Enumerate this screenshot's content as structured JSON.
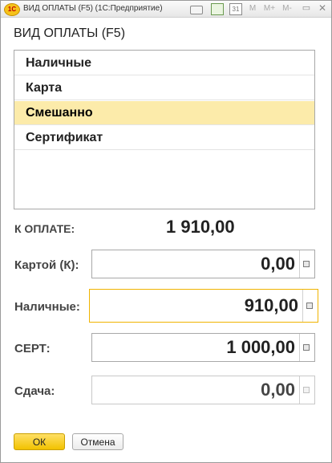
{
  "window": {
    "title": "ВИД ОПЛАТЫ (F5)  (1С:Предприятие)",
    "logo_text": "1С",
    "toolbar": {
      "m_label": "M",
      "m_plus_label": "M+",
      "m_minus_label": "M-",
      "calendar_label": "31"
    }
  },
  "form": {
    "title": "ВИД ОПЛАТЫ (F5)"
  },
  "payment_types": [
    {
      "label": "Наличные",
      "selected": false
    },
    {
      "label": "Карта",
      "selected": false
    },
    {
      "label": "Смешанно",
      "selected": true
    },
    {
      "label": "Сертификат",
      "selected": false
    }
  ],
  "to_pay": {
    "label": "К ОПЛАТЕ:",
    "amount": "1 910,00"
  },
  "fields": {
    "card": {
      "label": "Картой (К):",
      "value": "0,00"
    },
    "cash": {
      "label": "Наличные:",
      "value": "910,00"
    },
    "cert": {
      "label": "СЕРТ:",
      "value": "1 000,00"
    },
    "change": {
      "label": "Сдача:",
      "value": "0,00"
    }
  },
  "buttons": {
    "ok": "ОК",
    "cancel": "Отмена"
  },
  "colors": {
    "selection": "#fcebaa",
    "focus_border": "#f0b400",
    "ok_button": "#f2c200"
  }
}
